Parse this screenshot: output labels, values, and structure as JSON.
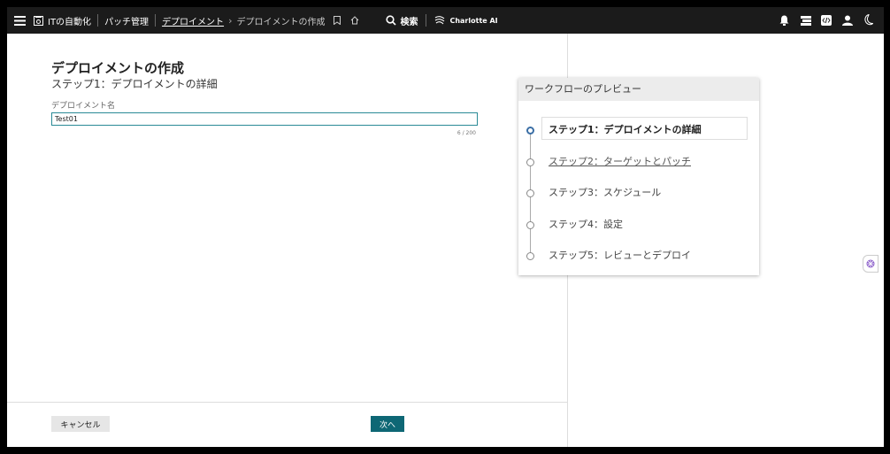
{
  "topbar": {
    "app": "ITの自動化",
    "patch": "パッチ管理",
    "deploy": "デプロイメント",
    "chevron": "›",
    "current": "デプロイメントの作成",
    "search": "検索",
    "ai": "Charlotte AI"
  },
  "form": {
    "title": "デプロイメントの作成",
    "subtitle": "ステップ1：デプロイメントの詳細",
    "name_label": "デプロイメント名",
    "name_value": "Test01",
    "counter": "6 / 200"
  },
  "footer": {
    "cancel": "キャンセル",
    "next": "次へ"
  },
  "workflow": {
    "header": "ワークフローのプレビュー",
    "steps": [
      {
        "label": "ステップ1：デプロイメントの詳細"
      },
      {
        "label": "ステップ2：ターゲットとパッチ"
      },
      {
        "label": "ステップ3：スケジュール"
      },
      {
        "label": "ステップ4：設定"
      },
      {
        "label": "ステップ5：レビューとデプロイ"
      }
    ]
  },
  "icons": {
    "menu": "hamburger-menu-icon",
    "app": "automation-app-icon",
    "bookmark": "bookmark-icon",
    "home": "home-icon",
    "search": "search-icon",
    "ai": "charlotte-ai-icon",
    "bell": "bell-icon",
    "layers": "layers-icon",
    "code": "code-icon",
    "user": "user-icon",
    "moon": "moon-icon",
    "side": "ai-assist-icon"
  },
  "colors": {
    "accent": "#0e6775",
    "input_border": "#2a8a96",
    "active_step": "#3a6ea5",
    "topbar": "#1b1b1b"
  }
}
